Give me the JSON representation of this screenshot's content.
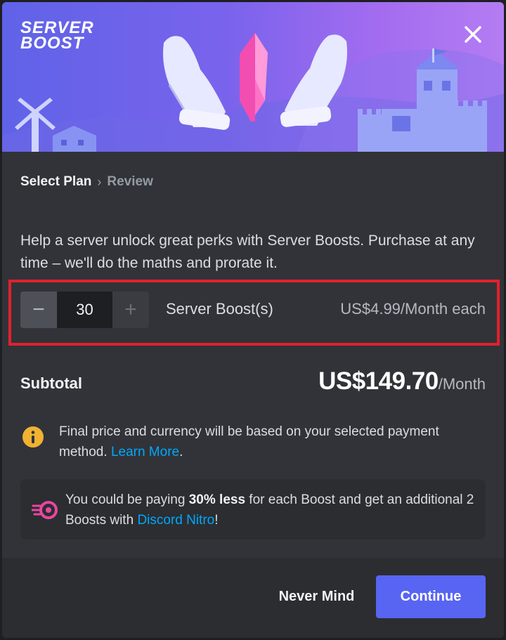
{
  "hero": {
    "title_line1": "SERVER",
    "title_line2": "BOOST",
    "close_icon": "close-icon"
  },
  "breadcrumb": {
    "active": "Select Plan",
    "separator": "›",
    "next": "Review"
  },
  "description": "Help a server unlock great perks with Server Boosts. Purchase at any time – we'll do the maths and prorate it.",
  "boost": {
    "minus_label": "−",
    "quantity": "30",
    "plus_label": "+",
    "unit_label": "Server Boost(s)",
    "price_each": "US$4.99/Month each"
  },
  "subtotal": {
    "label": "Subtotal",
    "amount": "US$149.70",
    "period": "/Month"
  },
  "info": {
    "icon": "info-icon",
    "text": "Final price and currency will be based on your selected payment method. ",
    "link": "Learn More",
    "suffix": "."
  },
  "nitro": {
    "icon": "nitro-icon",
    "text_before": "You could be paying ",
    "bold": "30% less",
    "text_middle": " for each Boost and get an additional 2 Boosts with ",
    "link": "Discord Nitro",
    "suffix": "!"
  },
  "footer": {
    "cancel_label": "Never Mind",
    "confirm_label": "Continue"
  },
  "colors": {
    "accent": "#5865f2",
    "link": "#00a8fc",
    "highlight": "#e2202e",
    "warning": "#f0b232",
    "nitro": "#eb459e"
  }
}
